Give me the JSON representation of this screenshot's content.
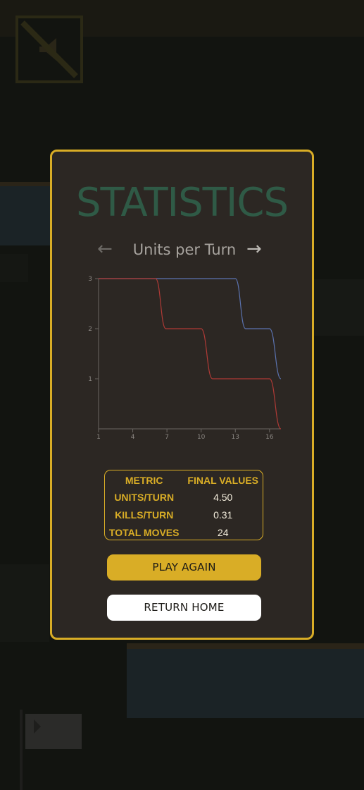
{
  "modal": {
    "title": "STATISTICS",
    "chart_nav": {
      "prev_icon": "←",
      "next_icon": "→",
      "label": "Units per Turn"
    },
    "table": {
      "headers": [
        "METRIC",
        "FINAL VALUES"
      ],
      "rows": [
        {
          "metric": "UNITS/TURN",
          "value": "4.50"
        },
        {
          "metric": "KILLS/TURN",
          "value": "0.31"
        },
        {
          "metric": "TOTAL MOVES",
          "value": "24"
        }
      ]
    },
    "buttons": {
      "play_again": "PLAY AGAIN",
      "return_home": "RETURN HOME"
    }
  },
  "colors": {
    "accent": "#d9ad26",
    "title": "#2f5a46",
    "panel": "#2c2723",
    "series_blue": "#5b73b0",
    "series_red": "#b03a36"
  },
  "icons": {
    "corner": "no-sound-icon",
    "flag": "flag-icon"
  },
  "chart_data": {
    "type": "line",
    "title": "Units per Turn",
    "xlabel": "",
    "ylabel": "",
    "xlim": [
      1,
      17
    ],
    "ylim": [
      0,
      3
    ],
    "x_ticks": [
      1,
      4,
      7,
      10,
      13,
      16
    ],
    "y_ticks": [
      1,
      2,
      3
    ],
    "grid": false,
    "legend": "none",
    "series": [
      {
        "color": "#5b73b0",
        "x": [
          1,
          13,
          13.9,
          16,
          17
        ],
        "y": [
          3,
          3,
          2,
          2,
          1
        ]
      },
      {
        "color": "#b03a36",
        "x": [
          1,
          6,
          6.9,
          10,
          11,
          16,
          17
        ],
        "y": [
          3,
          3,
          2,
          2,
          1,
          1,
          0
        ]
      }
    ]
  }
}
